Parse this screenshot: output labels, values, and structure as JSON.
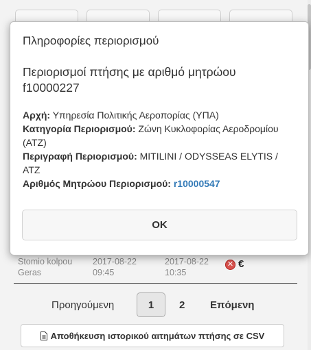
{
  "modal": {
    "title": "Πληροφορίες περιορισμού",
    "subtitle": "Περιορισμοί πτήσης με αριθμό μητρώου f10000227",
    "authority_label": "Αρχή:",
    "authority_value": "Υπηρεσία Πολιτικής Αεροπορίας (ΥΠΑ)",
    "category_label": "Κατηγορία Περιορισμού:",
    "category_value": "Ζώνη Κυκλοφορίας Αεροδρομίου (ATZ)",
    "description_label": "Περιγραφή Περιορισμού:",
    "description_value": "MITILINI / ODYSSEAS ELYTIS / ATZ",
    "registry_label": "Αριθμός Μητρώου Περιορισμού:",
    "registry_value": "r10000547",
    "ok_label": "OK"
  },
  "table_row": {
    "name_line1": "Stomio kolpou",
    "name_line2": "Geras",
    "start_date": "2017-08-22",
    "start_time": "09:45",
    "end_date": "2017-08-22",
    "end_time": "10:35",
    "status_icons": [
      "cancel-icon",
      "euro-icon"
    ],
    "cancel_glyph": "✕",
    "euro_glyph": "€"
  },
  "pagination": {
    "prev_label": "Προηγούμενη",
    "pages": [
      "1",
      "2"
    ],
    "current_page": "1",
    "next_label": "Επόμενη"
  },
  "export": {
    "csv_label": "Αποθήκευση ιστορικού αιτημάτων πτήσης σε CSV"
  },
  "colors": {
    "link": "#337ab7",
    "cancel": "#d9534f"
  }
}
